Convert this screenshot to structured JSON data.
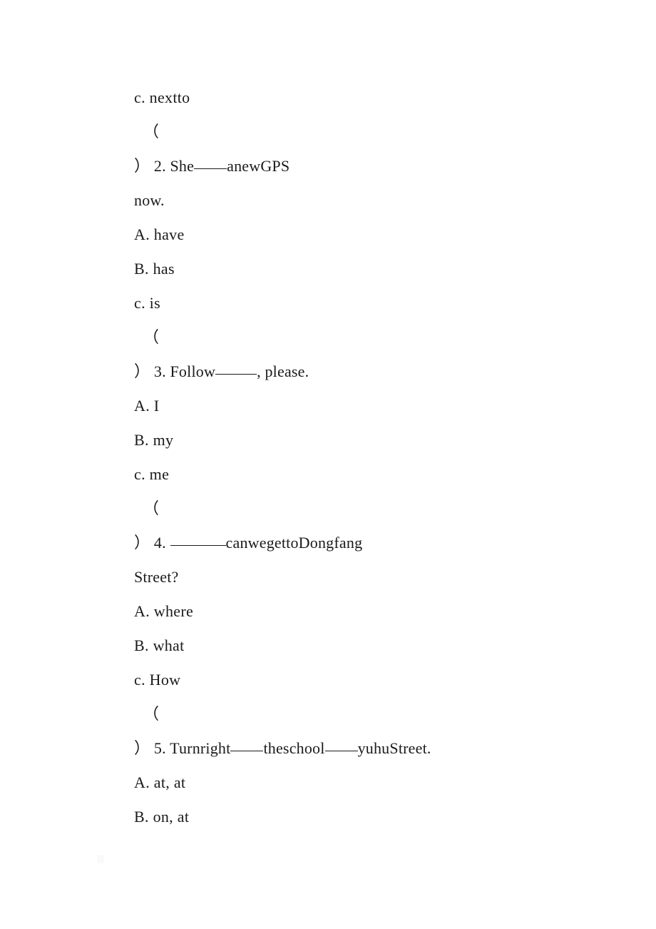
{
  "document": {
    "background_color": "#ffffff",
    "text_color": "#1a1a1a",
    "lines": [
      {
        "id": "l1",
        "text": "c. nextto"
      },
      {
        "id": "l2",
        "text": "（"
      },
      {
        "id": "l3a",
        "text": "） 2. She"
      },
      {
        "id": "l3b",
        "text": "anewGPS"
      },
      {
        "id": "l4",
        "text": "now."
      },
      {
        "id": "l5",
        "text": "A. have"
      },
      {
        "id": "l6",
        "text": "B. has"
      },
      {
        "id": "l7",
        "text": "c. is"
      },
      {
        "id": "l8",
        "text": "（"
      },
      {
        "id": "l9a",
        "text": "） 3. Follow"
      },
      {
        "id": "l9b",
        "text": ", please."
      },
      {
        "id": "l10",
        "text": "A. I"
      },
      {
        "id": "l11",
        "text": "B. my"
      },
      {
        "id": "l12",
        "text": "c. me"
      },
      {
        "id": "l13",
        "text": "（"
      },
      {
        "id": "l14a",
        "text": "） 4. "
      },
      {
        "id": "l14b",
        "text": "canwegettoDongfang"
      },
      {
        "id": "l15",
        "text": "Street?"
      },
      {
        "id": "l16",
        "text": "A. where"
      },
      {
        "id": "l17",
        "text": "B. what"
      },
      {
        "id": "l18",
        "text": "c. How"
      },
      {
        "id": "l19",
        "text": "（"
      },
      {
        "id": "l20a",
        "text": "） 5. Turnright"
      },
      {
        "id": "l20b",
        "text": "theschool"
      },
      {
        "id": "l20c",
        "text": "yuhuStreet."
      },
      {
        "id": "l21",
        "text": "A. at, at"
      },
      {
        "id": "l22",
        "text": "B. on, at"
      }
    ],
    "questions": [
      {
        "number": "2",
        "stem_prefix": "） 2. She",
        "stem_suffix": "anewGPS",
        "stem_continuation": "now.",
        "options": [
          "A. have",
          "B. has",
          "c. is"
        ]
      },
      {
        "number": "3",
        "stem_prefix": "） 3. Follow",
        "stem_suffix": ", please.",
        "options": [
          "A. I",
          "B. my",
          "c. me"
        ]
      },
      {
        "number": "4",
        "stem_prefix": "） 4. ",
        "stem_suffix": "canwegettoDongfang",
        "stem_continuation": "Street?",
        "options": [
          "A. where",
          "B. what",
          "c. How"
        ]
      },
      {
        "number": "5",
        "stem_prefix": "） 5. Turnright",
        "stem_middle": "theschool",
        "stem_suffix": "yuhuStreet.",
        "options": [
          "A. at, at",
          "B. on, at"
        ]
      }
    ],
    "orphan_option_top": "c. nextto",
    "paren_open": "（"
  }
}
